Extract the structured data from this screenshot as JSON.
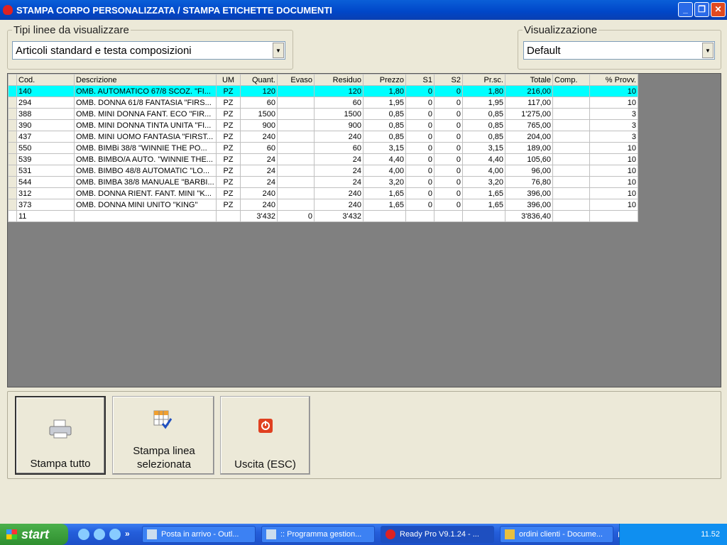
{
  "window": {
    "title": "STAMPA CORPO PERSONALIZZATA / STAMPA ETICHETTE DOCUMENTI",
    "minimize": "_",
    "restore": "❐",
    "close": "✕"
  },
  "filters": {
    "tipi_label": "Tipi linee da visualizzare",
    "tipi_value": "Articoli standard e testa composizioni",
    "vis_label": "Visualizzazione",
    "vis_value": "Default"
  },
  "grid": {
    "columns": [
      "Cod.",
      "Descrizione",
      "UM",
      "Quant.",
      "Evaso",
      "Residuo",
      "Prezzo",
      "S1",
      "S2",
      "Pr.sc.",
      "Totale",
      "Comp.",
      "% Provv."
    ],
    "selected_row": 0,
    "selected_color": "#00ffff",
    "rows": [
      [
        "140",
        "OMB. AUTOMATICO 67/8 SCOZ. \"FI...",
        "PZ",
        "120",
        "",
        "120",
        "1,80",
        "0",
        "0",
        "1,80",
        "216,00",
        "",
        "10"
      ],
      [
        "294",
        "OMB. DONNA 61/8 FANTASIA \"FIRS...",
        "PZ",
        "60",
        "",
        "60",
        "1,95",
        "0",
        "0",
        "1,95",
        "117,00",
        "",
        "10"
      ],
      [
        "388",
        "OMB. MINI DONNA FANT. ECO \"FIR...",
        "PZ",
        "1500",
        "",
        "1500",
        "0,85",
        "0",
        "0",
        "0,85",
        "1'275,00",
        "",
        "3"
      ],
      [
        "390",
        "OMB. MINI DONNA TINTA UNITA \"FI...",
        "PZ",
        "900",
        "",
        "900",
        "0,85",
        "0",
        "0",
        "0,85",
        "765,00",
        "",
        "3"
      ],
      [
        "437",
        "OMB. MINI UOMO FANTASIA \"FIRST...",
        "PZ",
        "240",
        "",
        "240",
        "0,85",
        "0",
        "0",
        "0,85",
        "204,00",
        "",
        "3"
      ],
      [
        "550",
        "OMB. BIMBi 38/8  \"WINNIE THE PO...",
        "PZ",
        "60",
        "",
        "60",
        "3,15",
        "0",
        "0",
        "3,15",
        "189,00",
        "",
        "10"
      ],
      [
        "539",
        "OMB. BIMBO/A AUTO. \"WINNIE THE...",
        "PZ",
        "24",
        "",
        "24",
        "4,40",
        "0",
        "0",
        "4,40",
        "105,60",
        "",
        "10"
      ],
      [
        "531",
        "OMB. BIMBO 48/8 AUTOMATIC \"LO...",
        "PZ",
        "24",
        "",
        "24",
        "4,00",
        "0",
        "0",
        "4,00",
        "96,00",
        "",
        "10"
      ],
      [
        "544",
        "OMB. BIMBA 38/8 MANUALE \"BARBI...",
        "PZ",
        "24",
        "",
        "24",
        "3,20",
        "0",
        "0",
        "3,20",
        "76,80",
        "",
        "10"
      ],
      [
        "312",
        "OMB. DONNA RIENT. FANT. MINI \"K...",
        "PZ",
        "240",
        "",
        "240",
        "1,65",
        "0",
        "0",
        "1,65",
        "396,00",
        "",
        "10"
      ],
      [
        "373",
        "OMB. DONNA MINI UNITO \"KING\"",
        "PZ",
        "240",
        "",
        "240",
        "1,65",
        "0",
        "0",
        "1,65",
        "396,00",
        "",
        "10"
      ]
    ],
    "totals": [
      "11",
      "",
      "",
      "3'432",
      "0",
      "3'432",
      "",
      "",
      "",
      "",
      "3'836,40",
      "",
      ""
    ]
  },
  "buttons": {
    "print_all": "Stampa tutto",
    "print_line": "Stampa linea selezionata",
    "exit": "Uscita (ESC)"
  },
  "taskbar": {
    "start": "start",
    "more": "»",
    "tasks": [
      "Posta in arrivo - Outl...",
      ":: Programma gestion...",
      "Ready Pro V9.1.24 - ...",
      "ordini clienti - Docume..."
    ],
    "lang": "IT",
    "clock": "11.52"
  }
}
